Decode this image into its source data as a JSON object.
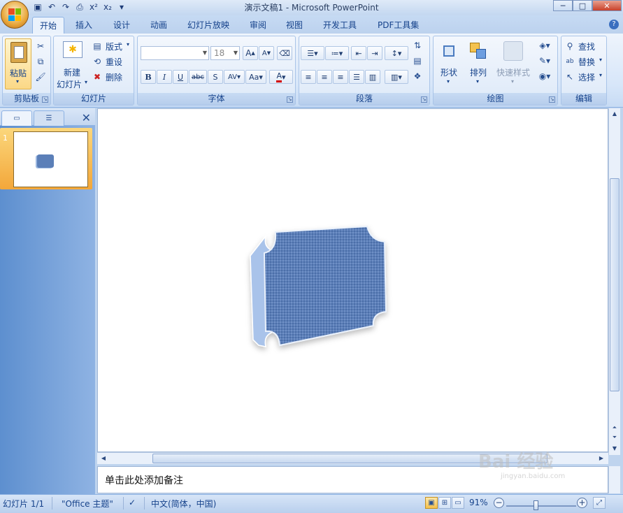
{
  "window": {
    "title": "演示文稿1 - Microsoft PowerPoint"
  },
  "tabs": [
    "开始",
    "插入",
    "设计",
    "动画",
    "幻灯片放映",
    "审阅",
    "视图",
    "开发工具",
    "PDF工具集"
  ],
  "ribbon": {
    "clipboard": {
      "paste": "粘贴",
      "label": "剪贴板"
    },
    "slides": {
      "new_slide_line1": "新建",
      "new_slide_line2": "幻灯片",
      "layout": "版式",
      "reset": "重设",
      "delete": "删除",
      "label": "幻灯片"
    },
    "font": {
      "font_size": "18",
      "label": "字体",
      "bold": "B",
      "italic": "I",
      "underline": "U",
      "strike": "abc",
      "shadow": "S",
      "spacing": "AV",
      "case": "Aa",
      "color": "A",
      "grow": "A",
      "shrink": "A"
    },
    "paragraph": {
      "label": "段落"
    },
    "drawing": {
      "shapes": "形状",
      "arrange": "排列",
      "quick_styles": "快速样式",
      "label": "绘图"
    },
    "editing": {
      "find": "查找",
      "replace": "替换",
      "select": "选择",
      "label": "编辑"
    }
  },
  "slide_panel": {
    "slide_number": "1"
  },
  "notes": {
    "placeholder": "单击此处添加备注"
  },
  "status": {
    "slide_info": "幻灯片 1/1",
    "theme": "\"Office 主题\"",
    "language": "中文(简体，中国)",
    "zoom": "91%"
  },
  "watermark": {
    "main": "Bai 经验",
    "sub": "jingyan.baidu.com"
  },
  "colors": {
    "accent": "#15428b",
    "shape_fill": "#5b7fb8",
    "shape_side": "#a9c3ea"
  }
}
